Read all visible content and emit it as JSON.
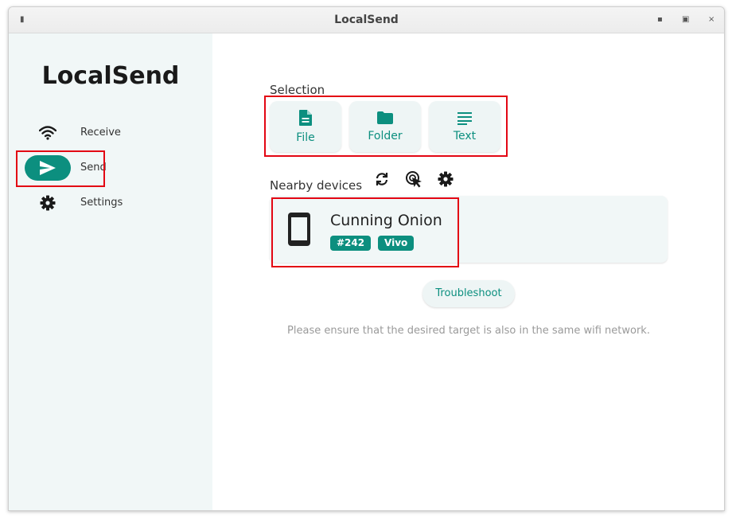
{
  "window": {
    "title": "LocalSend",
    "pin_icon": "pin-icon",
    "minimize_icon": "minimize-icon",
    "maximize_icon": "maximize-icon",
    "close_icon": "close-icon"
  },
  "sidebar": {
    "app_title": "LocalSend",
    "items": [
      {
        "label": "Receive",
        "icon": "wifi-icon",
        "active": false
      },
      {
        "label": "Send",
        "icon": "send-icon",
        "active": true
      },
      {
        "label": "Settings",
        "icon": "gear-icon",
        "active": false
      }
    ]
  },
  "main": {
    "selection_label": "Selection",
    "selection_buttons": [
      {
        "label": "File",
        "icon": "file-icon"
      },
      {
        "label": "Folder",
        "icon": "folder-icon"
      },
      {
        "label": "Text",
        "icon": "text-lines-icon"
      }
    ],
    "nearby_label": "Nearby devices",
    "nearby_actions": [
      "refresh-icon",
      "scan-cursor-icon",
      "gear-icon"
    ],
    "device": {
      "name": "Cunning Onion",
      "icon": "smartphone-icon",
      "badges": [
        "#242",
        "Vivo"
      ]
    },
    "troubleshoot_label": "Troubleshoot",
    "hint": "Please ensure that the desired target is also in the same wifi network."
  },
  "colors": {
    "accent": "#0c8f7f",
    "sidebar_bg": "#f1f7f7",
    "highlight": "#e30613"
  }
}
